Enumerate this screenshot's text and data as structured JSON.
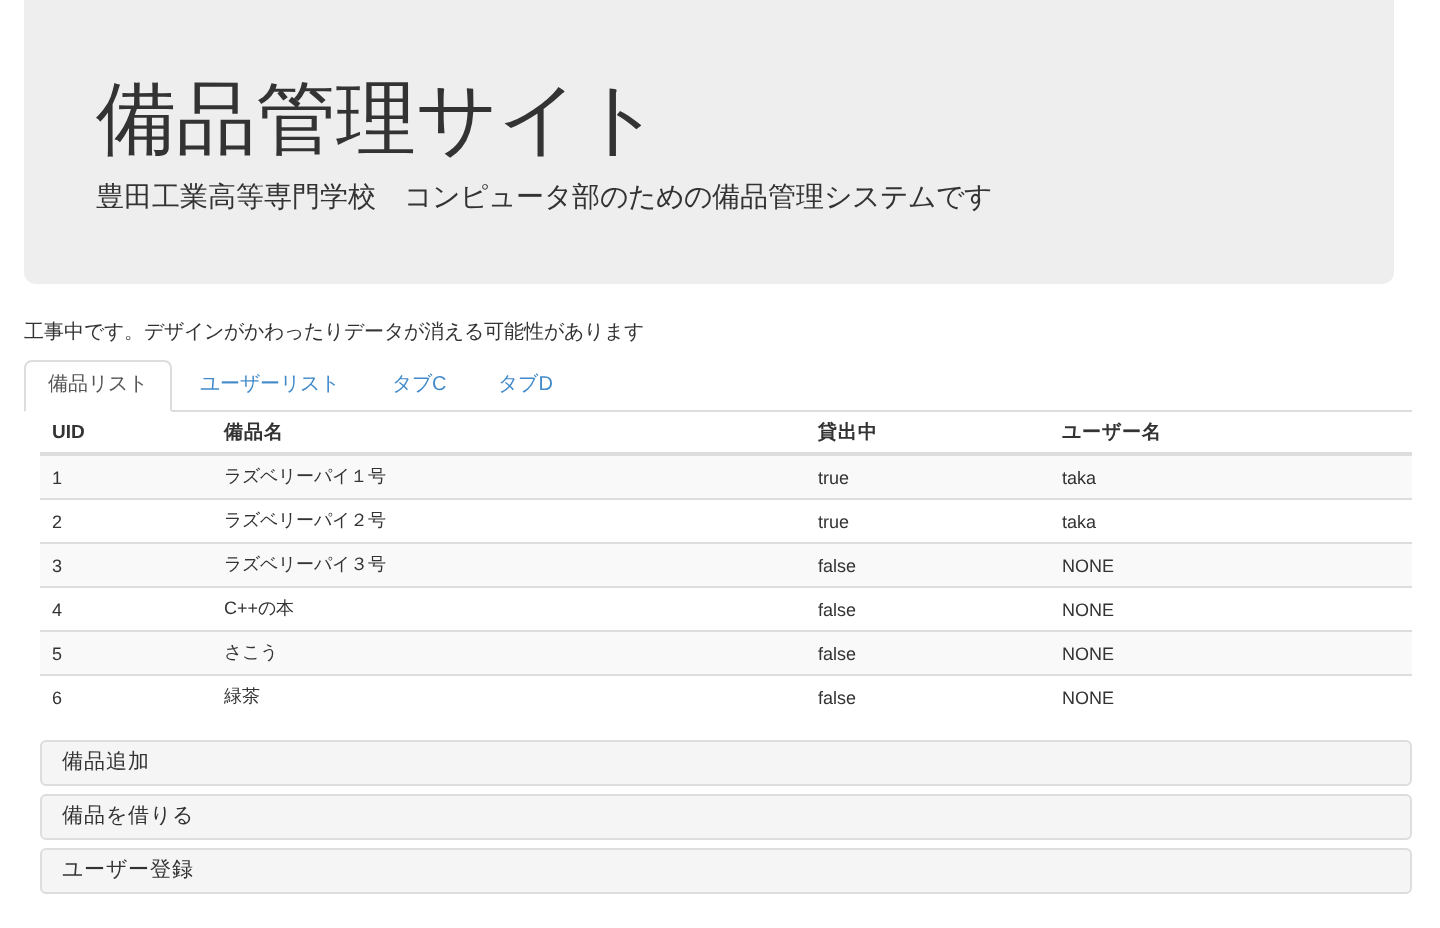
{
  "header": {
    "title": "備品管理サイト",
    "subtitle": "豊田工業高等専門学校　コンピュータ部のための備品管理システムです"
  },
  "notice": "工事中です。デザインがかわったりデータが消える可能性があります",
  "tabs": [
    {
      "label": "備品リスト",
      "selected": true
    },
    {
      "label": "ユーザーリスト",
      "selected": false
    },
    {
      "label": "タブC",
      "selected": false
    },
    {
      "label": "タブD",
      "selected": false
    }
  ],
  "table": {
    "columns": [
      "UID",
      "備品名",
      "貸出中",
      "ユーザー名"
    ],
    "rows": [
      [
        "1",
        "ラズベリーパイ１号",
        "true",
        "taka"
      ],
      [
        "2",
        "ラズベリーパイ２号",
        "true",
        "taka"
      ],
      [
        "3",
        "ラズベリーパイ３号",
        "false",
        "NONE"
      ],
      [
        "4",
        "C++の本",
        "false",
        "NONE"
      ],
      [
        "5",
        "さこう",
        "false",
        "NONE"
      ],
      [
        "6",
        "緑茶",
        "false",
        "NONE"
      ]
    ]
  },
  "panels": [
    "備品追加",
    "備品を借りる",
    "ユーザー登録"
  ]
}
